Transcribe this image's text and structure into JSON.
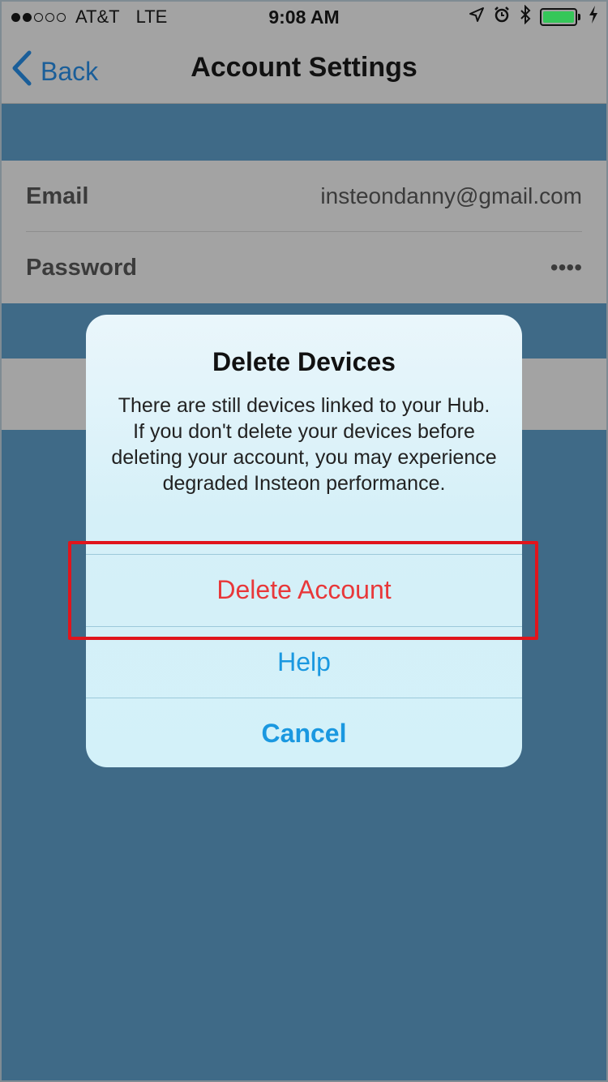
{
  "status_bar": {
    "carrier": "AT&T",
    "network": "LTE",
    "time": "9:08 AM",
    "signal_bars_filled": 2,
    "signal_bars_total": 5,
    "battery_level": 1.0,
    "battery_color": "#35c759"
  },
  "nav": {
    "back_label": "Back",
    "title": "Account Settings",
    "tint_color": "#1a5e99"
  },
  "settings": {
    "rows": [
      {
        "label": "Email",
        "value": "insteondanny@gmail.com"
      },
      {
        "label": "Password",
        "value": "••••"
      }
    ]
  },
  "alert": {
    "title": "Delete Devices",
    "message": "There are still devices linked to your Hub. If you don't delete your devices before deleting your account, you may experience degraded Insteon performance.",
    "actions": {
      "delete": "Delete Account",
      "help": "Help",
      "cancel": "Cancel"
    },
    "destructive_color": "#e8383a",
    "action_color": "#1a98e0"
  },
  "highlight_color": "#e0151c",
  "background_color": "#3f6a87"
}
